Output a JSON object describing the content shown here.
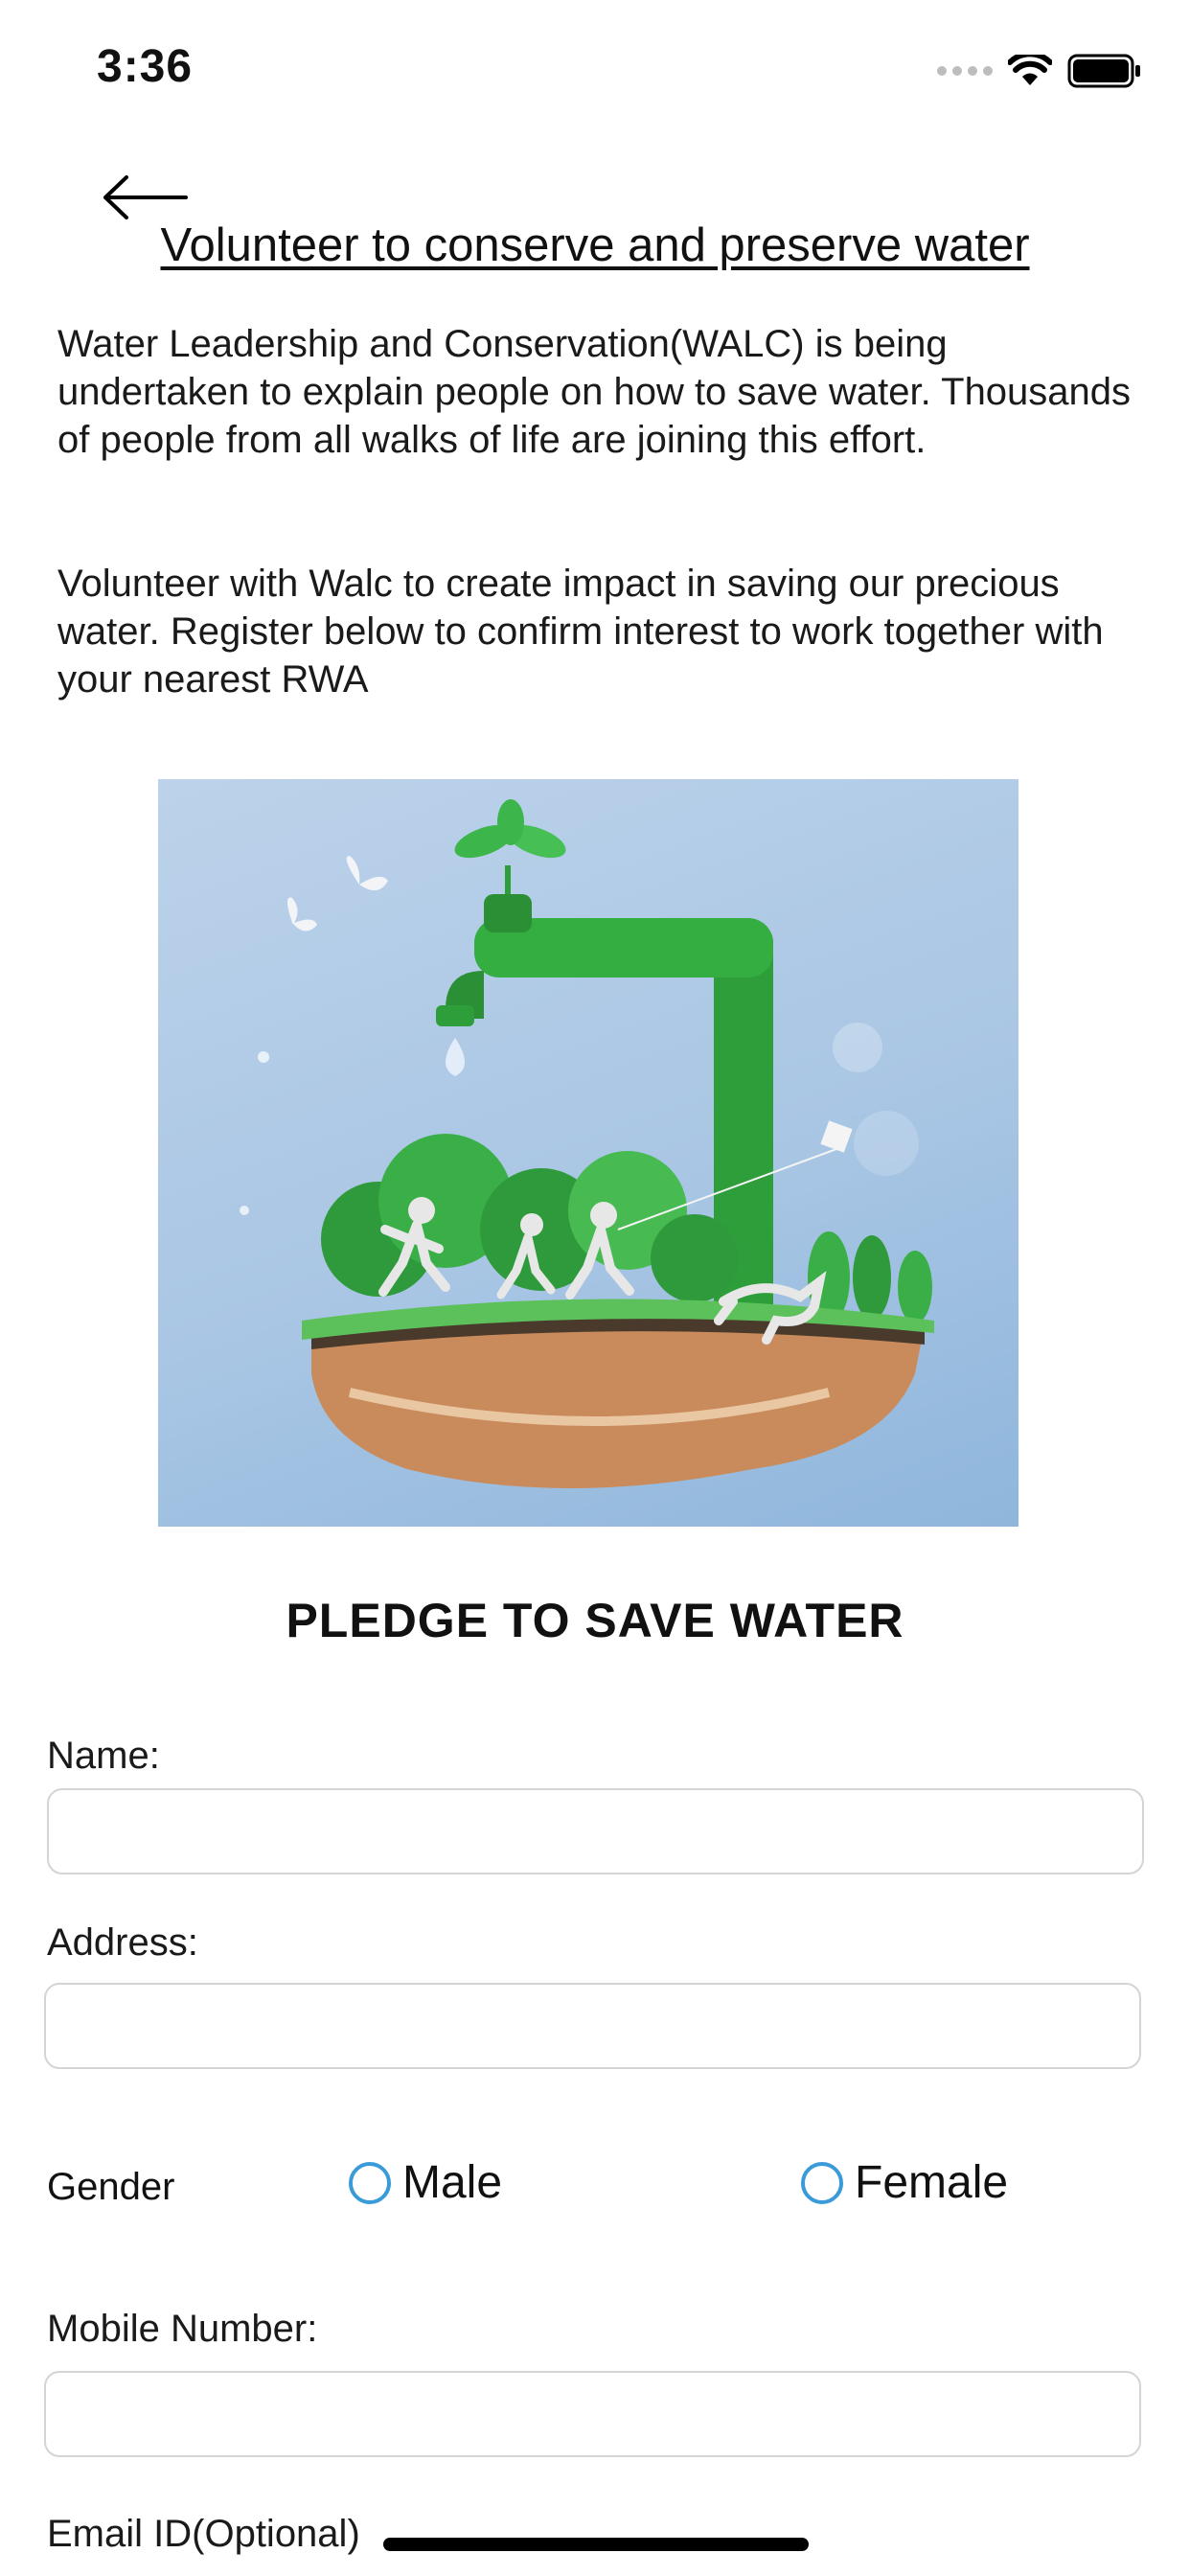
{
  "status_bar": {
    "time": "3:36"
  },
  "header": {
    "back_icon": "arrow-left-icon",
    "title": "Volunteer to conserve and preserve water"
  },
  "intro": {
    "paragraph1": "Water Leadership and Conservation(WALC) is being undertaken to explain people on how to save water. Thousands of people from all walks of life are joining this effort.",
    "paragraph2": "Volunteer with Walc to create impact in saving our precious water. Register below to confirm interest to work together with your nearest RWA"
  },
  "pledge_heading": "PLEDGE TO SAVE WATER",
  "form": {
    "name_label": "Name:",
    "name_value": "",
    "address_label": "Address:",
    "address_value": "",
    "gender_label": "Gender",
    "gender_options": [
      "Male",
      "Female"
    ],
    "mobile_label": "Mobile Number:",
    "mobile_value": "",
    "email_label": "Email ID(Optional)"
  },
  "colors": {
    "radio_accent": "#3a9bd8",
    "illustration_bg": "#a9c6e4",
    "green": "#2e9e3a"
  }
}
